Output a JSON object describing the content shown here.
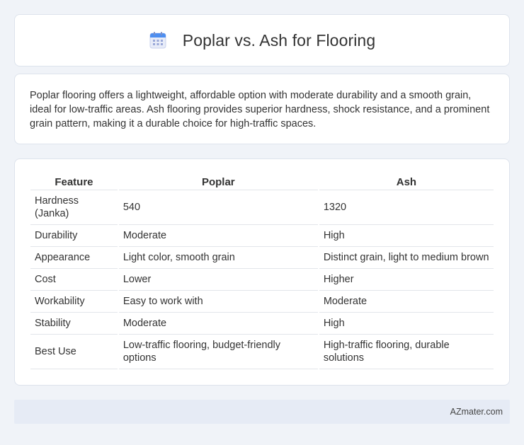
{
  "header": {
    "icon": "calendar-icon",
    "title": "Poplar vs. Ash for Flooring"
  },
  "description": {
    "text": "Poplar flooring offers a lightweight, affordable option with moderate durability and a smooth grain, ideal for low-traffic areas. Ash flooring provides superior hardness, shock resistance, and a prominent grain pattern, making it a durable choice for high-traffic spaces."
  },
  "table": {
    "headers": [
      "Feature",
      "Poplar",
      "Ash"
    ],
    "rows": [
      [
        "Hardness (Janka)",
        "540",
        "1320"
      ],
      [
        "Durability",
        "Moderate",
        "High"
      ],
      [
        "Appearance",
        "Light color, smooth grain",
        "Distinct grain, light to medium brown"
      ],
      [
        "Cost",
        "Lower",
        "Higher"
      ],
      [
        "Workability",
        "Easy to work with",
        "Moderate"
      ],
      [
        "Stability",
        "Moderate",
        "High"
      ],
      [
        "Best Use",
        "Low-traffic flooring, budget-friendly options",
        "High-traffic flooring, durable solutions"
      ]
    ]
  },
  "footer": {
    "brand": "AZmater.com"
  },
  "colors": {
    "background": "#f0f3f8",
    "card": "#ffffff",
    "footer": "#e6ebf5",
    "icon_accent": "#4d8ef0"
  }
}
